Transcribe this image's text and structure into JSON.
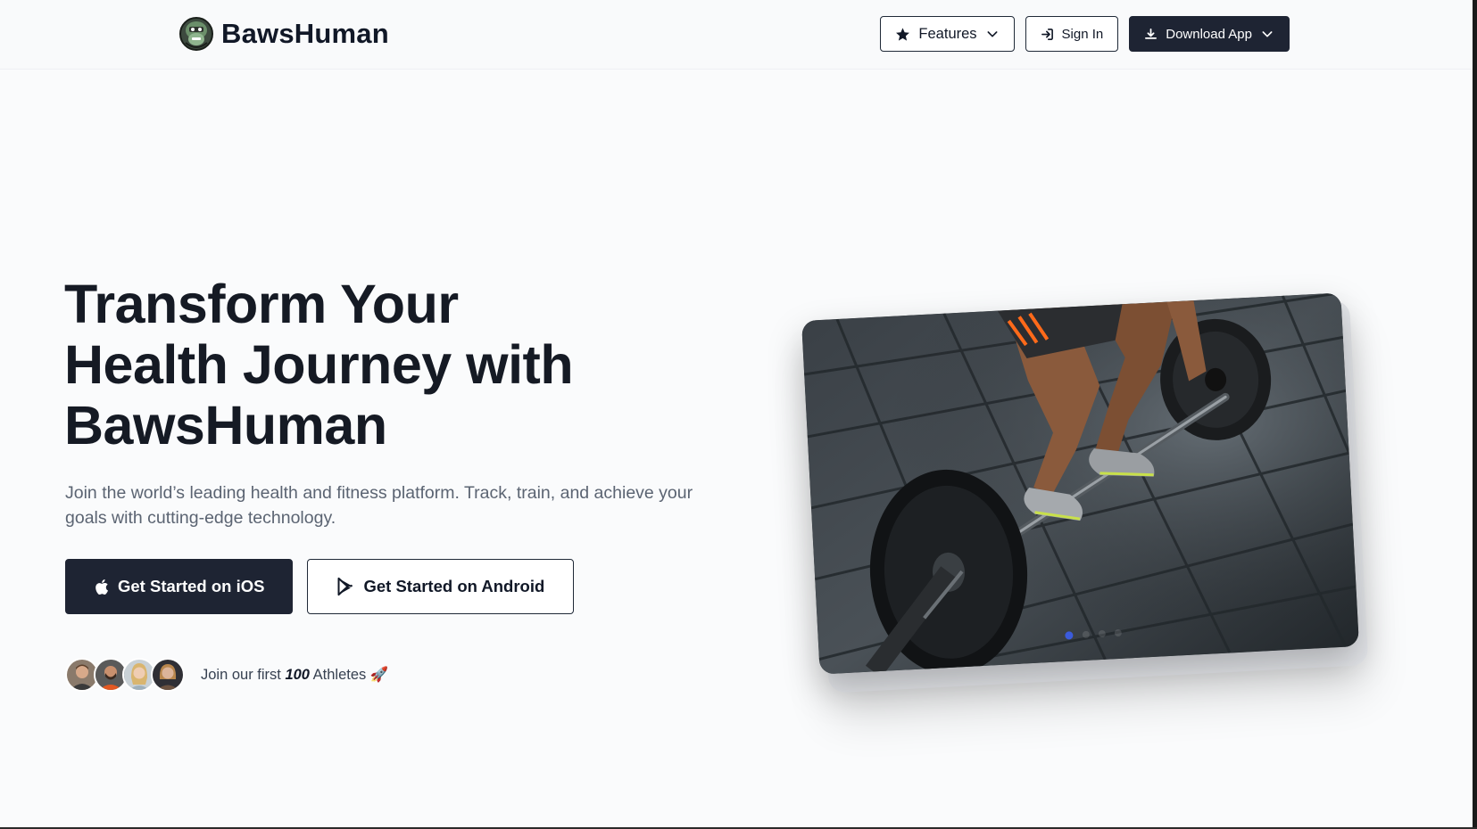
{
  "brand": {
    "name": "BawsHuman"
  },
  "nav": {
    "features_label": "Features",
    "signin_label": "Sign In",
    "download_label": "Download App"
  },
  "hero": {
    "title_lines": [
      "Transform Your",
      "Health Journey with",
      "BawsHuman"
    ],
    "subtitle": "Join the world’s leading health and fitness platform. Track, train, and achieve your goals with cutting-edge technology.",
    "cta_ios": "Get Started on iOS",
    "cta_android": "Get Started on Android"
  },
  "athletes": {
    "prefix": "Join our first ",
    "count": "100",
    "suffix": " Athletes 🚀",
    "avatar_count": 4
  },
  "carousel": {
    "slide_count": 4,
    "active_index": 0
  },
  "colors": {
    "primary_dark": "#1e2433",
    "background": "#fafbfc",
    "muted_text": "#5b6472",
    "carousel_dot_active": "#3b5bdb"
  }
}
